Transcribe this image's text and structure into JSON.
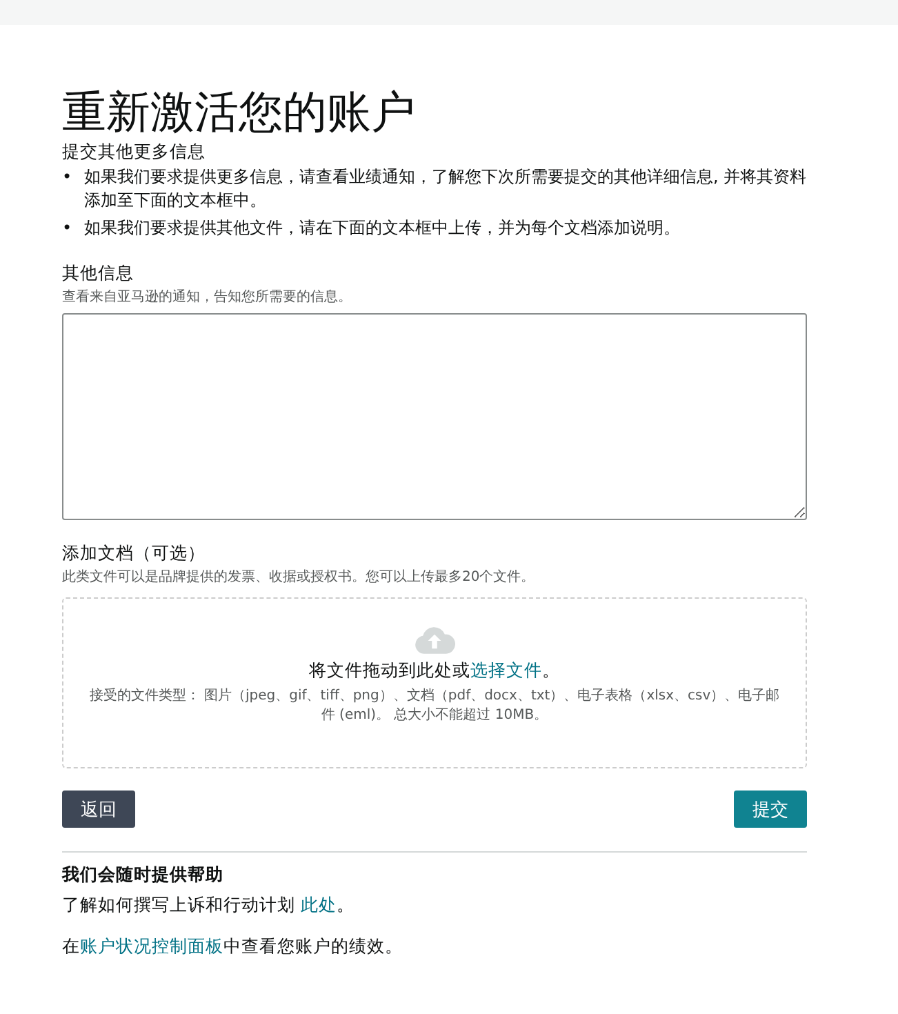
{
  "title": "重新激活您的账户",
  "subtitle": "提交其他更多信息",
  "bullets": [
    {
      "marker": "•",
      "text": "如果我们要求提供更多信息，请查看业绩通知，了解您下次所需要提交的其他详细信息, 并将其资料添加至下面的文本框中。"
    },
    {
      "marker": "•",
      "text": "如果我们要求提供其他文件，请在下面的文本框中上传，并为每个文档添加说明。"
    }
  ],
  "info": {
    "label": "其他信息",
    "hint": "查看来自亚马逊的通知，告知您所需要的信息。"
  },
  "documents": {
    "label": "添加文档（可选）",
    "hint": "此类文件可以是品牌提供的发票、收据或授权书。您可以上传最多20个文件。",
    "drop_text": "将文件拖动到此处或",
    "drop_link": "选择文件",
    "drop_end": "。",
    "accepted": "接受的文件类型： 图片（jpeg、gif、tiff、png）、文档（pdf、docx、txt）、电子表格（xlsx、csv）、电子邮件 (eml)。 总大小不能超过 10MB。"
  },
  "buttons": [
    {
      "label": "返回",
      "kind": "secondary"
    },
    {
      "label": "提交",
      "kind": "primary"
    }
  ],
  "help": {
    "title": "我们会随时提供帮助",
    "lines": [
      {
        "before": "了解如何撰写上诉和行动计划 ",
        "link": "此处",
        "after": "。"
      },
      {
        "before": "在",
        "link": "账户状况控制面板",
        "after": "中查看您账户的绩效。"
      }
    ]
  }
}
